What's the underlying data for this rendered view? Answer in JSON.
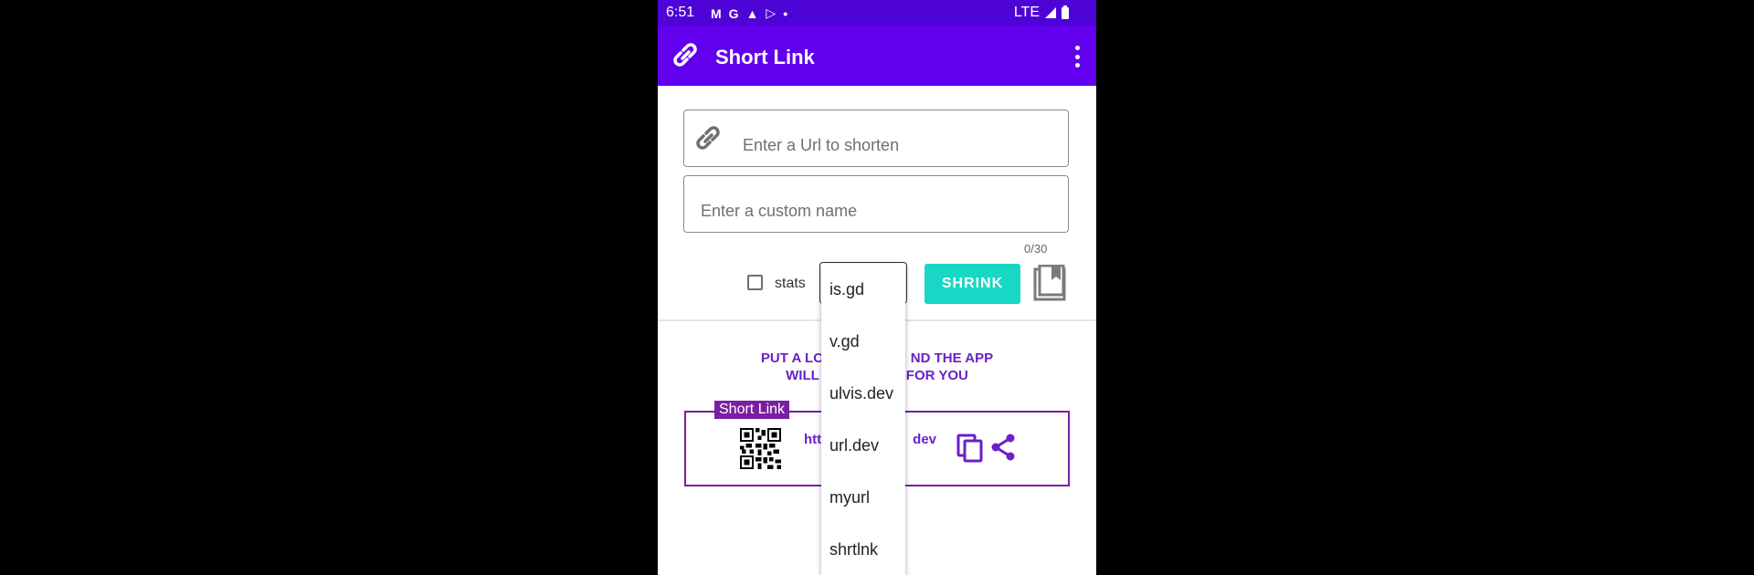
{
  "status_bar": {
    "time": "6:51",
    "network": "LTE",
    "icons": [
      "gmail-icon",
      "google-icon",
      "app-icon",
      "play-icon",
      "dot-icon"
    ]
  },
  "app_bar": {
    "title": "Short Link",
    "color": "#6200ee"
  },
  "form": {
    "url_placeholder": "Enter a Url to shorten",
    "url_value": "",
    "name_placeholder": "Enter a custom name",
    "name_value": "",
    "counter": "0/30",
    "stats_label": "stats",
    "stats_checked": false,
    "shrink_label": "SHRINK"
  },
  "dropdown": {
    "options": [
      "is.gd",
      "v.gd",
      "ulvis.dev",
      "url.dev",
      "myurl",
      "shrtlnk"
    ]
  },
  "hint": {
    "line1_left": "PUT A LO",
    "line1_right": "ND THE APP",
    "line2_left": "WILL",
    "line2_right": "FOR YOU"
  },
  "result": {
    "legend": "Short Link",
    "url_left": "htt",
    "url_right": "dev"
  },
  "colors": {
    "status_bar": "#4e04d6",
    "accent": "#6200ee",
    "button": "#18d7c4",
    "result_border": "#7b1fa2",
    "hint_text": "#6a1fc7"
  }
}
